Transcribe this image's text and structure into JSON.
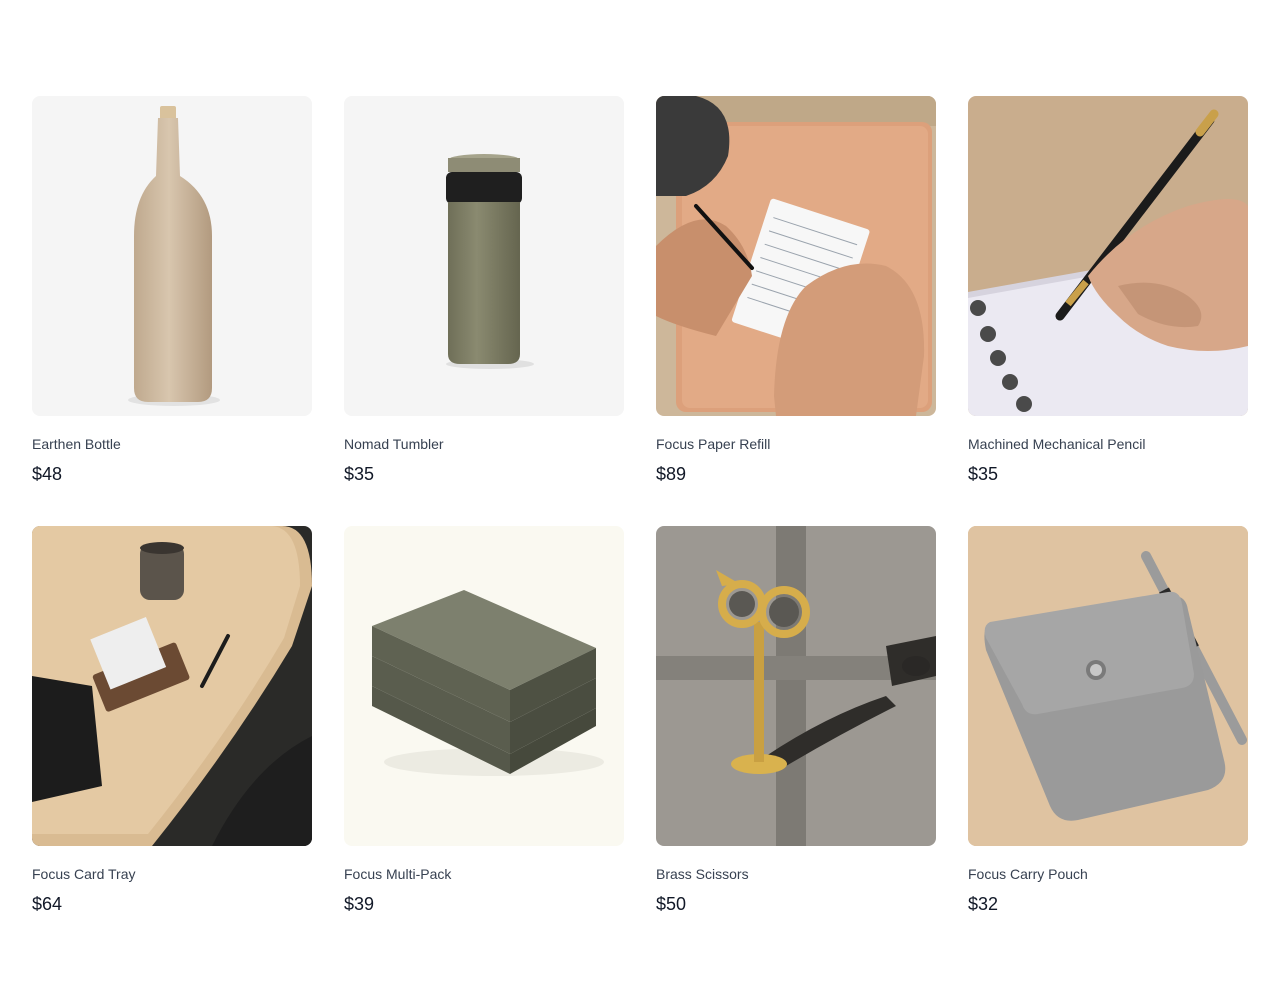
{
  "products": [
    {
      "name": "Earthen Bottle",
      "price": "$48"
    },
    {
      "name": "Nomad Tumbler",
      "price": "$35"
    },
    {
      "name": "Focus Paper Refill",
      "price": "$89"
    },
    {
      "name": "Machined Mechanical Pencil",
      "price": "$35"
    },
    {
      "name": "Focus Card Tray",
      "price": "$64"
    },
    {
      "name": "Focus Multi-Pack",
      "price": "$39"
    },
    {
      "name": "Brass Scissors",
      "price": "$50"
    },
    {
      "name": "Focus Carry Pouch",
      "price": "$32"
    }
  ]
}
